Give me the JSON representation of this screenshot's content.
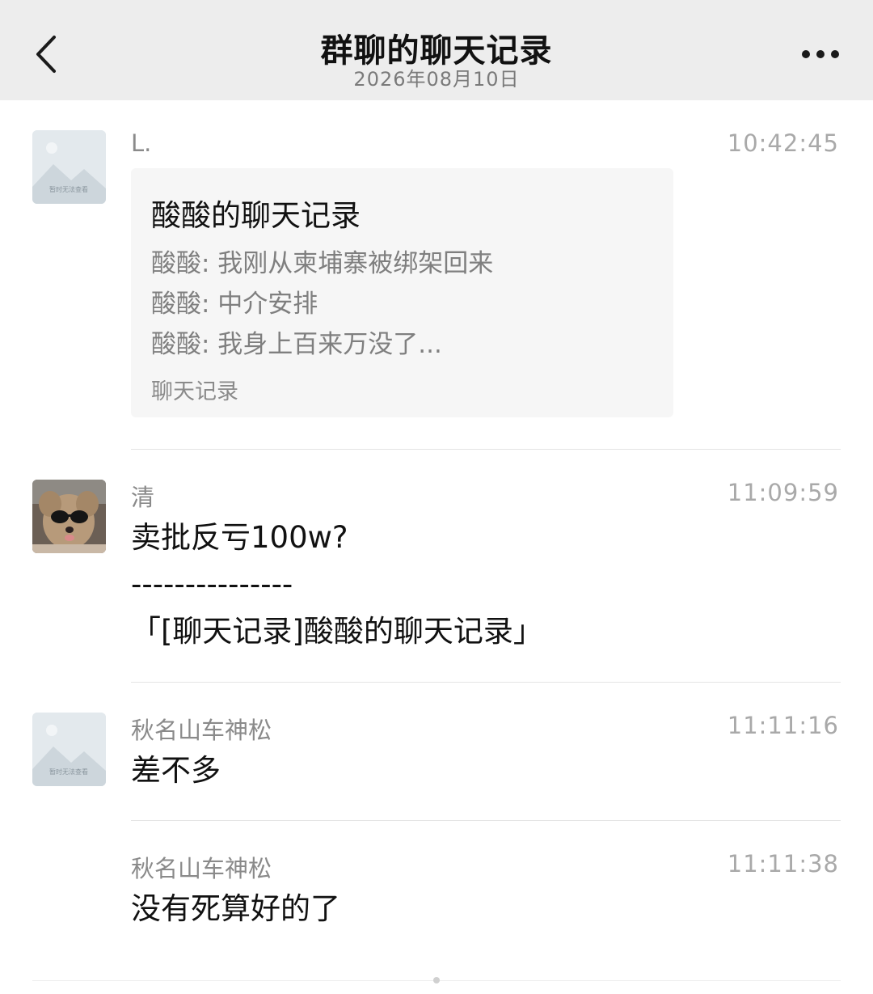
{
  "header": {
    "title": "群聊的聊天记录",
    "date": "2026年08月10日"
  },
  "messages": [
    {
      "sender": "L.",
      "time": "10:42:45",
      "avatar": "placeholder-image-icon",
      "avatar_caption": "暂时无法查看",
      "card": {
        "title": "酸酸的聊天记录",
        "lines": [
          "酸酸: 我刚从柬埔寨被绑架回来",
          "酸酸: 中介安排",
          "酸酸: 我身上百来万没了..."
        ],
        "footer": "聊天记录"
      }
    },
    {
      "sender": "清",
      "time": "11:09:59",
      "avatar": "dog-with-sunglasses-photo",
      "lines": [
        "卖批反亏100w?",
        "---------------",
        "「[聊天记录]酸酸的聊天记录」"
      ]
    },
    {
      "sender": "秋名山车神松",
      "time": "11:11:16",
      "avatar": "placeholder-image-icon",
      "avatar_caption": "暂时无法查看",
      "lines": [
        "差不多"
      ]
    },
    {
      "sender": "秋名山车神松",
      "time": "11:11:38",
      "lines": [
        "没有死算好的了"
      ]
    }
  ],
  "colors": {
    "header_bg": "#ededed",
    "card_bg": "#f6f6f6",
    "muted_text": "#8a8a8a",
    "divider": "#e4e4e4"
  }
}
